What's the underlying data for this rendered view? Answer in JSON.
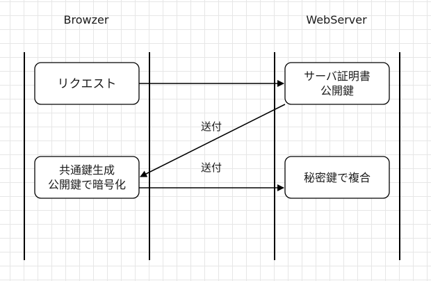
{
  "lanes": {
    "browser": "Browzer",
    "server": "WebServer"
  },
  "nodes": {
    "request": "リクエスト",
    "cert_line1": "サーバ証明書",
    "cert_line2": "公開鍵",
    "shared_line1": "共通鍵生成",
    "shared_line2": "公開鍵で暗号化",
    "decrypt": "秘密鍵で複合"
  },
  "edges": {
    "send_cert": "送付",
    "send_key": "送付"
  }
}
